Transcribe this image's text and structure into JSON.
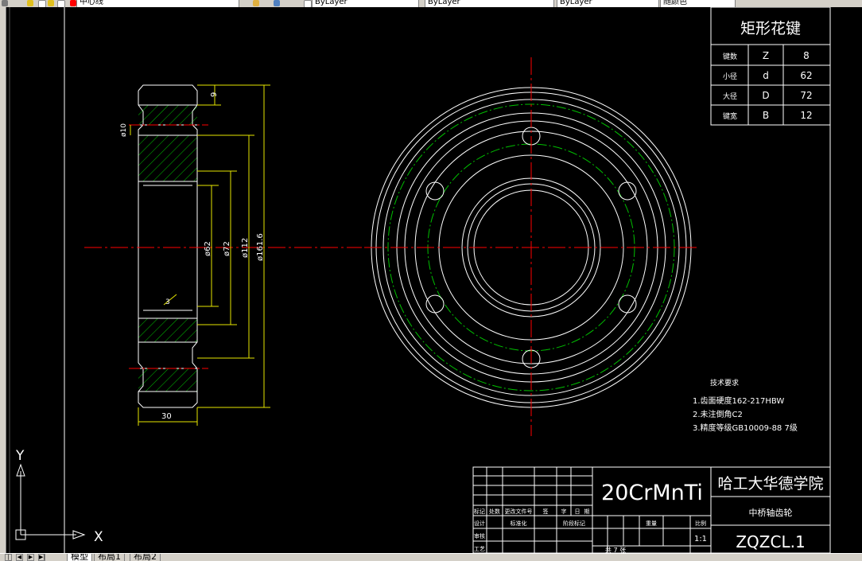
{
  "toolbar": {
    "linetype_field": "中心线",
    "color_field": "ByLayer",
    "linetype_field2": "ByLayer",
    "lineweight_field": "ByLayer",
    "plotstyle_field": "随颜色"
  },
  "spline_table": {
    "title": "矩形花键",
    "rows": [
      {
        "label": "键数",
        "symbol": "Z",
        "value": "8"
      },
      {
        "label": "小径",
        "symbol": "d",
        "value": "62"
      },
      {
        "label": "大径",
        "symbol": "D",
        "value": "72"
      },
      {
        "label": "键宽",
        "symbol": "B",
        "value": "12"
      }
    ]
  },
  "dimensions": {
    "d9": "9",
    "d10": "ø10",
    "d62": "ø62",
    "d72": "ø72",
    "d112": "ø112",
    "d161": "ø161.6",
    "d30": "30",
    "chamfer": "3"
  },
  "tech_notes": {
    "title": "技术要求",
    "lines": [
      "1.齿面硬度162-217HBW",
      "2.未注倒角C2",
      "3.精度等级GB10009-88 7级"
    ]
  },
  "title_block": {
    "material": "20CrMnTi",
    "school": "哈工大华德学院",
    "part_name": "中桥轴齿轮",
    "drawing_no": "ZQZCL.1",
    "scale": "1:1",
    "row_labels_a": [
      "标记",
      "处数",
      "更改文件号",
      "签",
      "字",
      "日",
      "期"
    ],
    "row_labels_b": [
      "设计",
      "",
      "标准化",
      "",
      "阶段标记"
    ],
    "col_headers": [
      "重量",
      "比例"
    ],
    "review_label": "审核",
    "process_label": "工艺",
    "sheet_text": "共 7 张"
  },
  "ucs": {
    "x_label": "X",
    "y_label": "Y"
  },
  "tabs": {
    "model": "模型",
    "layout1": "布局1",
    "layout2": "布局2"
  },
  "nav_buttons": [
    "|◀",
    "◀",
    "▶",
    "▶|"
  ]
}
